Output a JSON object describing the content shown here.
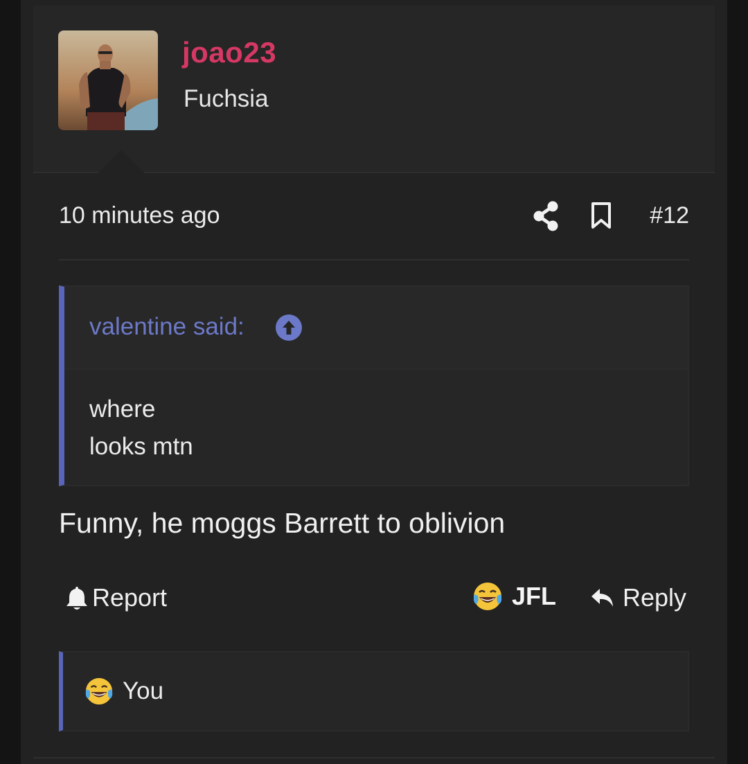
{
  "post": {
    "username": "joao23",
    "user_title": "Fuchsia",
    "timestamp": "10 minutes ago",
    "post_number": "#12",
    "quote": {
      "author": "valentine said:",
      "lines": [
        "where",
        "looks mtn"
      ]
    },
    "body": "Funny, he moggs Barrett to oblivion",
    "actions": {
      "report": "Report",
      "jfl": "JFL",
      "reply": "Reply"
    },
    "reactions_summary": "You"
  },
  "colors": {
    "username": "#d63864",
    "quote_accent": "#5865b8",
    "quote_author": "#6c79c8",
    "background": "#222222"
  },
  "icons": {
    "share": "share-icon",
    "bookmark": "bookmark-icon",
    "quote_jump": "arrow-circle-up-icon",
    "report": "bell-icon",
    "jfl": "laughing-tears-emoji",
    "reply": "reply-arrow-icon"
  }
}
